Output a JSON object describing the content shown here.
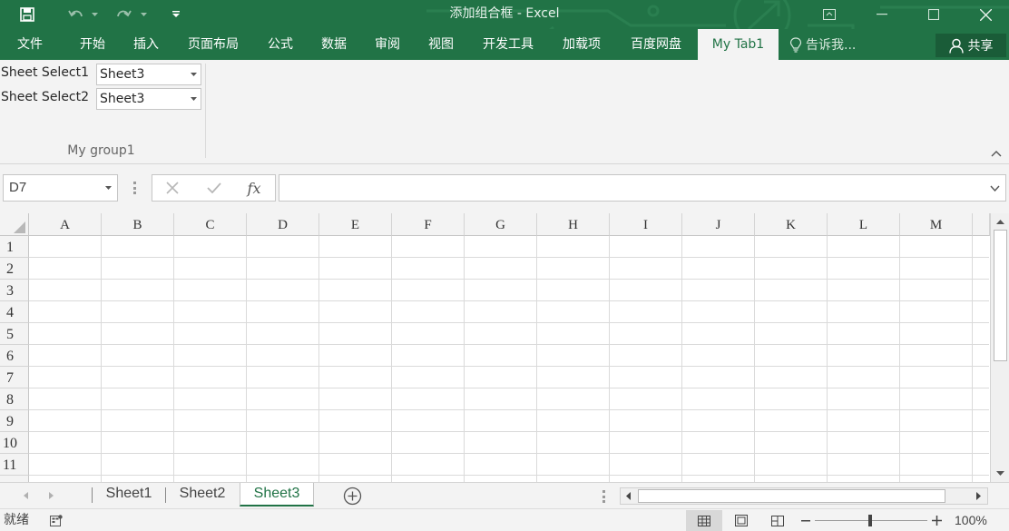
{
  "window": {
    "title": "添加组合框 - Excel"
  },
  "ribbon_tabs": [
    "文件",
    "开始",
    "插入",
    "页面布局",
    "公式",
    "数据",
    "审阅",
    "视图",
    "开发工具",
    "加载项",
    "百度网盘",
    "My Tab1"
  ],
  "active_tab": "My Tab1",
  "tell_me": "告诉我...",
  "share": "共享",
  "custom_group": {
    "label": "My group1",
    "controls": [
      {
        "label": "Sheet Select1",
        "value": "Sheet3"
      },
      {
        "label": "Sheet Select2",
        "value": "Sheet3"
      }
    ]
  },
  "formula_bar": {
    "name_box": "D7",
    "fx_label": "fx",
    "formula": ""
  },
  "grid": {
    "columns": [
      "A",
      "B",
      "C",
      "D",
      "E",
      "F",
      "G",
      "H",
      "I",
      "J",
      "K",
      "L",
      "M"
    ],
    "rows": [
      "1",
      "2",
      "3",
      "4",
      "5",
      "6",
      "7",
      "8",
      "9",
      "10",
      "11"
    ]
  },
  "sheets": [
    "Sheet1",
    "Sheet2",
    "Sheet3"
  ],
  "active_sheet": "Sheet3",
  "status": {
    "ready": "就绪",
    "zoom": "100%"
  },
  "colors": {
    "excel_green": "#217346",
    "ribbon_bg": "#f3f3f3"
  }
}
